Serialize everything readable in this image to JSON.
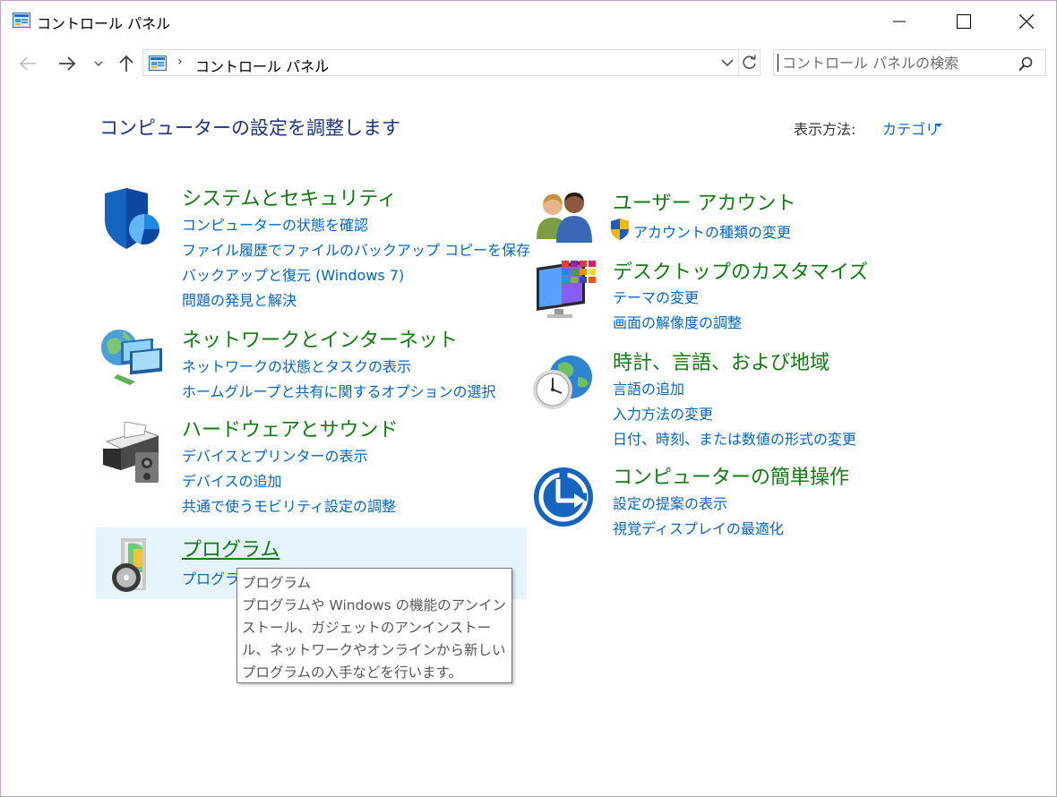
{
  "window": {
    "title": "コントロール パネル"
  },
  "address": {
    "path": "コントロール パネル",
    "separator": "›"
  },
  "search": {
    "placeholder": "コントロール パネルの検索"
  },
  "header": {
    "title": "コンピューターの設定を調整します",
    "view_by_label": "表示方法:",
    "view_by_value": "カテゴリ"
  },
  "categories": {
    "system": {
      "title": "システムとセキュリティ",
      "links": [
        "コンピューターの状態を確認",
        "ファイル履歴でファイルのバックアップ コピーを保存",
        "バックアップと復元 (Windows 7)",
        "問題の発見と解決"
      ]
    },
    "network": {
      "title": "ネットワークとインターネット",
      "links": [
        "ネットワークの状態とタスクの表示",
        "ホームグループと共有に関するオプションの選択"
      ]
    },
    "hardware": {
      "title": "ハードウェアとサウンド",
      "links": [
        "デバイスとプリンターの表示",
        "デバイスの追加",
        "共通で使うモビリティ設定の調整"
      ]
    },
    "programs": {
      "title": "プログラム",
      "links": [
        "プログラム"
      ]
    },
    "users": {
      "title": "ユーザー アカウント",
      "links": [
        "アカウントの種類の変更"
      ]
    },
    "desktop": {
      "title": "デスクトップのカスタマイズ",
      "links": [
        "テーマの変更",
        "画面の解像度の調整"
      ]
    },
    "clock": {
      "title": "時計、言語、および地域",
      "links": [
        "言語の追加",
        "入力方法の変更",
        "日付、時刻、または数値の形式の変更"
      ]
    },
    "ease": {
      "title": "コンピューターの簡単操作",
      "links": [
        "設定の提案の表示",
        "視覚ディスプレイの最適化"
      ]
    }
  },
  "tooltip": {
    "title": "プログラム",
    "body": "プログラムや Windows の機能のアンインストール、ガジェットのアンインストール、ネットワークやオンラインから新しいプログラムの入手などを行います。"
  },
  "colors": {
    "category_title": "#107c10",
    "link": "#0066cc",
    "page_title": "#1e3287",
    "hover_bg": "#e5f3fb"
  }
}
